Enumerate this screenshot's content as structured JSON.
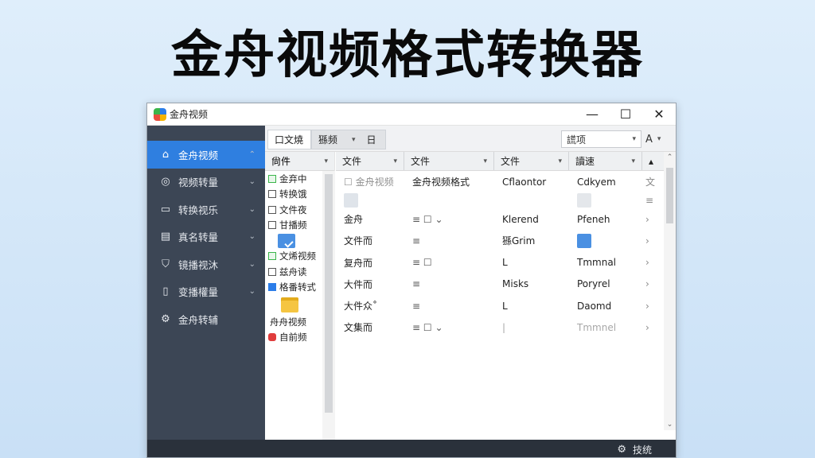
{
  "banner": {
    "title": "金舟视频格式转换器"
  },
  "window": {
    "title": "金舟视频",
    "controls": {
      "minimize": "—",
      "maximize": "☐",
      "close": "✕"
    }
  },
  "sidebar": {
    "items": [
      {
        "label": "金舟视频",
        "icon": "home-icon",
        "glyph": "⌂",
        "chevron": "⌃"
      },
      {
        "label": "视频转量",
        "icon": "eye-icon",
        "glyph": "◎",
        "chevron": "⌄"
      },
      {
        "label": "转换视乐",
        "icon": "monitor-icon",
        "glyph": "▭",
        "chevron": "⌄"
      },
      {
        "label": "真名转量",
        "icon": "document-icon",
        "glyph": "▤",
        "chevron": "⌄"
      },
      {
        "label": "镜播视沐",
        "icon": "shield-icon",
        "glyph": "⛉",
        "chevron": "⌄"
      },
      {
        "label": "变播權量",
        "icon": "tablet-icon",
        "glyph": "▯",
        "chevron": "⌄"
      },
      {
        "label": "金舟转辅",
        "icon": "gear-icon",
        "glyph": "⚙",
        "chevron": ""
      }
    ]
  },
  "toolbar": {
    "tab1": "口文燒",
    "tab2": "猻频",
    "tab2_dropdown": "▾",
    "tab2_calendar": "日",
    "select": "謊项",
    "select_dropdown": "▾",
    "font_button": "A",
    "font_dropdown": "▾"
  },
  "tree": {
    "header": "尙件",
    "header_dropdown": "▾",
    "items": [
      {
        "label": "金弃中",
        "check": "green"
      },
      {
        "label": "转换饿",
        "check": "plain"
      },
      {
        "label": "文件夜",
        "check": "plain"
      },
      {
        "label": "甘播频",
        "check": "plain"
      },
      {
        "label": "",
        "check": "none",
        "thumb": true
      },
      {
        "label": "文烯视频",
        "check": "green"
      },
      {
        "label": "兹舟读",
        "check": "plain"
      },
      {
        "label": "格番转式",
        "check": "blue"
      },
      {
        "label": "",
        "check": "none",
        "folder": true
      },
      {
        "label": "舟舟视频",
        "check": "none"
      },
      {
        "label": "自前频",
        "check": "red"
      }
    ],
    "scroll_down": "⌄"
  },
  "list": {
    "headers": [
      "文件",
      "文件",
      "文件",
      "讀速",
      "▴"
    ],
    "header_dropdown": "▾",
    "rows": [
      {
        "c1": "☐ 金舟视频",
        "c2": "金舟视频格式",
        "c3": "Cflaontor",
        "c4": "Cdkyem",
        "c5": "文",
        "c1_faded": true
      },
      {
        "c1": "",
        "c2": "",
        "c3": "",
        "c4": "",
        "c5": "≡",
        "thumbs": true
      },
      {
        "c1": "金舟",
        "c2": "≡ ☐ ⌄",
        "c3": "Klerend",
        "c4": "Pfeneh",
        "c5": "›"
      },
      {
        "c1": "文件而",
        "c2": "≡",
        "c3": "猻Grim",
        "c4": "",
        "c5": "›",
        "c4_thumb": true
      },
      {
        "c1": "复舟而",
        "c2": "≡ ☐",
        "c3": "L",
        "c4": "Tmmnal",
        "c5": "›"
      },
      {
        "c1": "大件而",
        "c2": "≡",
        "c3": "Misks",
        "c4": "Poryrel",
        "c5": "›"
      },
      {
        "c1": "大件众˚",
        "c2": "≡",
        "c3": "L",
        "c4": "Daomd",
        "c5": "›"
      },
      {
        "c1": "文集而",
        "c2": "≡ ☐ ⌄",
        "c3": "|",
        "c4": "Tmmnel",
        "c5": "›",
        "faded": true
      }
    ],
    "scroll_up": "⌃",
    "scroll_down": "⌄"
  },
  "hscroll": {
    "left": "‹",
    "right": "›"
  },
  "statusbar": {
    "icon": "gear-icon",
    "glyph": "⚙",
    "label": "技统"
  }
}
